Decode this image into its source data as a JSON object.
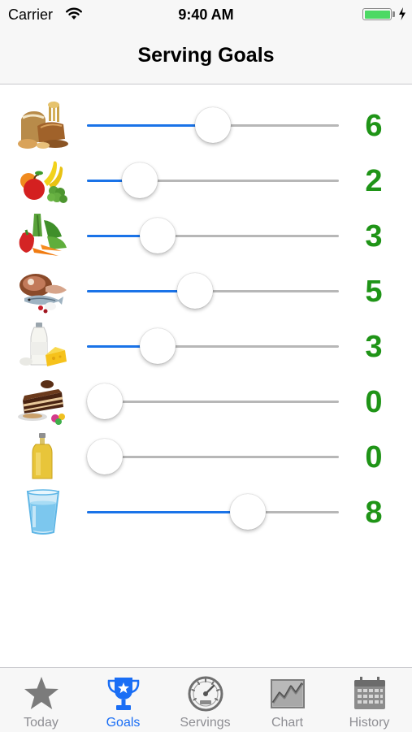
{
  "status_bar": {
    "carrier": "Carrier",
    "time": "9:40 AM"
  },
  "nav": {
    "title": "Serving Goals"
  },
  "colors": {
    "accent": "#1a73e8",
    "value_green": "#1f9417",
    "tab_active": "#1a6ef5",
    "tab_inactive": "#8e8e93"
  },
  "goals": [
    {
      "category": "grains",
      "icon": "grains-icon",
      "value": "6",
      "slider_level": 0.5
    },
    {
      "category": "fruits",
      "icon": "fruits-icon",
      "value": "2",
      "slider_level": 0.21
    },
    {
      "category": "vegetables",
      "icon": "vegetables-icon",
      "value": "3",
      "slider_level": 0.28
    },
    {
      "category": "meat-fish",
      "icon": "meat-fish-icon",
      "value": "5",
      "slider_level": 0.43
    },
    {
      "category": "dairy",
      "icon": "dairy-icon",
      "value": "3",
      "slider_level": 0.28
    },
    {
      "category": "sweets",
      "icon": "sweets-icon",
      "value": "0",
      "slider_level": 0.0
    },
    {
      "category": "oils",
      "icon": "oil-icon",
      "value": "0",
      "slider_level": 0.0
    },
    {
      "category": "water",
      "icon": "water-icon",
      "value": "8",
      "slider_level": 0.64
    }
  ],
  "tabs": [
    {
      "label": "Today",
      "icon": "star-icon",
      "active": false
    },
    {
      "label": "Goals",
      "icon": "trophy-icon",
      "active": true
    },
    {
      "label": "Servings",
      "icon": "gauge-icon",
      "active": false
    },
    {
      "label": "Chart",
      "icon": "chart-icon",
      "active": false
    },
    {
      "label": "History",
      "icon": "calendar-icon",
      "active": false
    }
  ]
}
